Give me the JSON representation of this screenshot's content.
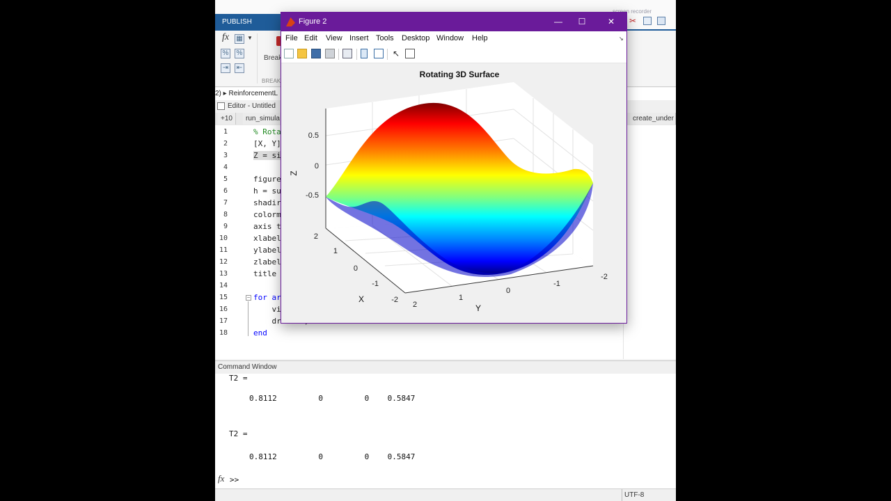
{
  "ribbon": {
    "tab_publish": "PUBLISH",
    "breakpoints_label": "Break",
    "breakpoints_section": "BREAK"
  },
  "breadcrumb": {
    "path": "2)  ▸  ReinforcementL"
  },
  "editor": {
    "title": "Editor - Untitled",
    "tabs": [
      "+10",
      "run_simula",
      "create_under"
    ],
    "lines": [
      {
        "n": "1",
        "text": "% Rota",
        "kind": "comment"
      },
      {
        "n": "2",
        "text": "[X, Y]",
        "kind": "code"
      },
      {
        "n": "3",
        "text": "Z = si",
        "kind": "highlight"
      },
      {
        "n": "4",
        "text": "",
        "kind": "code"
      },
      {
        "n": "5",
        "text": "figure",
        "kind": "code"
      },
      {
        "n": "6",
        "text": "h = su",
        "kind": "code"
      },
      {
        "n": "7",
        "text": "shadir",
        "kind": "code"
      },
      {
        "n": "8",
        "text": "colorm",
        "kind": "code"
      },
      {
        "n": "9",
        "text": "axis t",
        "kind": "code"
      },
      {
        "n": "10",
        "text": "xlabel",
        "kind": "code"
      },
      {
        "n": "11",
        "text": "ylabel",
        "kind": "code"
      },
      {
        "n": "12",
        "text": "zlabel",
        "kind": "code"
      },
      {
        "n": "13",
        "text": "title",
        "kind": "code"
      },
      {
        "n": "14",
        "text": "",
        "kind": "code"
      },
      {
        "n": "15",
        "text": "for ar",
        "kind": "keyword"
      },
      {
        "n": "16",
        "text": "    vi",
        "kind": "code"
      },
      {
        "n": "17",
        "text": "    drawnow;",
        "kind": "code"
      },
      {
        "n": "18",
        "text": "end",
        "kind": "keyword"
      }
    ]
  },
  "command_window": {
    "title": "Command Window",
    "lines": [
      {
        "text": "T2 =",
        "top": 0,
        "left": 20
      },
      {
        "text": "0.8112         0         0    0.5847",
        "top": 29,
        "left": 49
      },
      {
        "text": "T2 =",
        "top": 80,
        "left": 20
      },
      {
        "text": "0.8112         0         0    0.5847",
        "top": 113,
        "left": 49
      }
    ],
    "prompt": ">>"
  },
  "statusbar": {
    "encoding": "UTF-8"
  },
  "figure": {
    "window_title": "Figure 2",
    "menus": [
      "File",
      "Edit",
      "View",
      "Insert",
      "Tools",
      "Desktop",
      "Window",
      "Help"
    ],
    "toolbar_icons": [
      "new-file-icon",
      "open-folder-icon",
      "save-icon",
      "print-icon",
      "print-preview-icon",
      "link-plot-icon",
      "insert-legend-icon",
      "pointer-icon",
      "property-editor-icon"
    ],
    "plot": {
      "title": "Rotating 3D Surface",
      "zlabel": "Z",
      "xlabel": "X",
      "ylabel": "Y",
      "z_ticks": [
        "0.5",
        "0",
        "-0.5"
      ],
      "x_ticks": [
        "2",
        "1",
        "0",
        "-1",
        "-2"
      ],
      "y_ticks": [
        "2",
        "1",
        "0",
        "-1",
        "-2"
      ],
      "colormap": "jet",
      "shading": "interp"
    }
  },
  "overlay": {
    "top_right_label": "screen recorder"
  }
}
